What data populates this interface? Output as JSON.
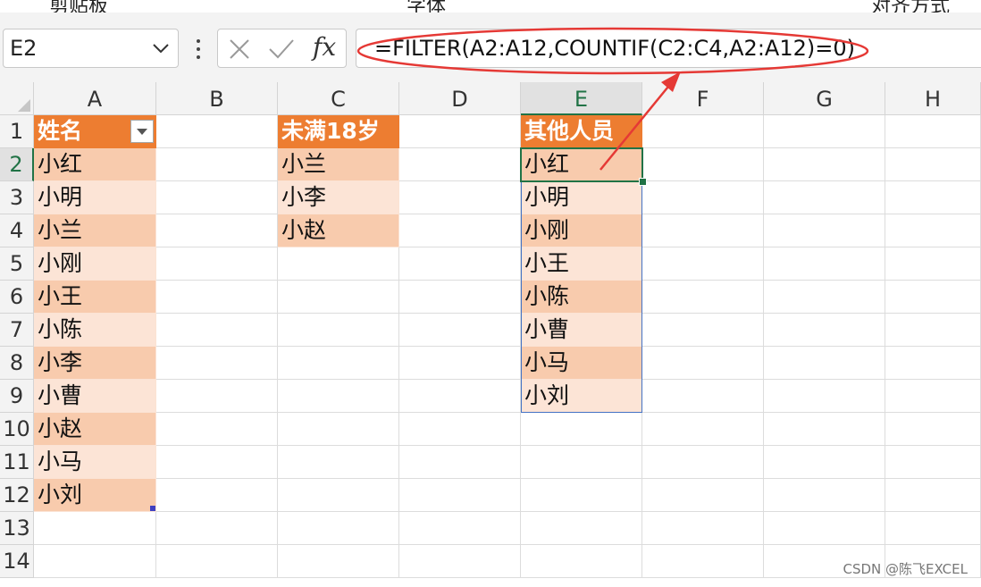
{
  "ribbon": {
    "groups": [
      "剪贴板",
      "字体",
      "对齐方式"
    ]
  },
  "formula_bar": {
    "name_box": "E2",
    "fx_label": "fx",
    "formula": "=FILTER(A2:A12,COUNTIF(C2:C4,A2:A12)=0)"
  },
  "columns": [
    "A",
    "B",
    "C",
    "D",
    "E",
    "F",
    "G",
    "H"
  ],
  "rows": [
    "1",
    "2",
    "3",
    "4",
    "5",
    "6",
    "7",
    "8",
    "9",
    "10",
    "11",
    "12",
    "13",
    "14"
  ],
  "table_a": {
    "header": "姓名",
    "values": [
      "小红",
      "小明",
      "小兰",
      "小刚",
      "小王",
      "小陈",
      "小李",
      "小曹",
      "小赵",
      "小马",
      "小刘"
    ]
  },
  "table_c": {
    "header": "未满18岁",
    "values": [
      "小兰",
      "小李",
      "小赵"
    ]
  },
  "table_e": {
    "header": "其他人员",
    "values": [
      "小红",
      "小明",
      "小刚",
      "小王",
      "小陈",
      "小曹",
      "小马",
      "小刘"
    ]
  },
  "colors": {
    "header_fill": "#ED7D31",
    "band_dark": "#F8CBAD",
    "band_light": "#FCE4D6",
    "selection": "#217346",
    "annotation": "#E53935"
  },
  "watermark": "CSDN @陈飞EXCEL"
}
